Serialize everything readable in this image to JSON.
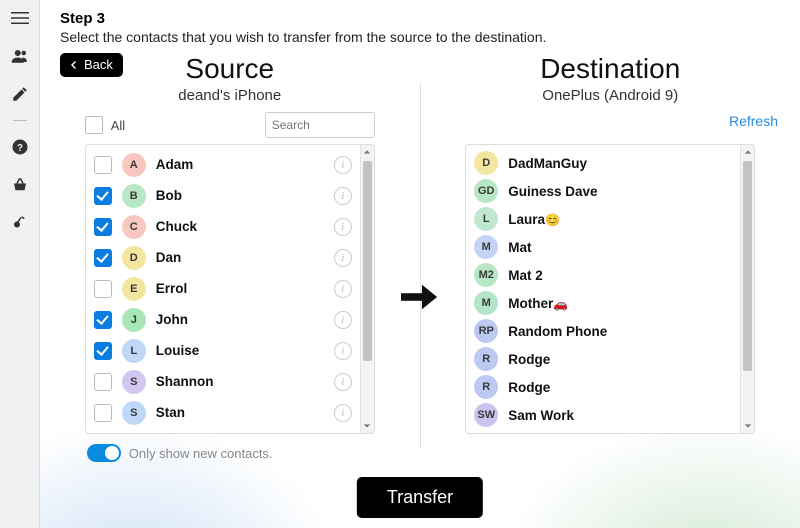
{
  "step": {
    "title": "Step 3",
    "desc": "Select the contacts that you wish to transfer from the source to the destination."
  },
  "back_label": "Back",
  "transfer_label": "Transfer",
  "source": {
    "title": "Source",
    "subtitle": "deand's iPhone",
    "all_label": "All",
    "search_placeholder": "Search",
    "toggle_label": "Only show new contacts.",
    "toggle_on": true,
    "contacts": [
      {
        "initial": "A",
        "name": "Adam",
        "color": "#f7c7c0",
        "checked": false
      },
      {
        "initial": "B",
        "name": "Bob",
        "color": "#b9e6c4",
        "checked": true
      },
      {
        "initial": "C",
        "name": "Chuck",
        "color": "#f7c7c0",
        "checked": true
      },
      {
        "initial": "D",
        "name": "Dan",
        "color": "#f3e6a0",
        "checked": true
      },
      {
        "initial": "E",
        "name": "Errol",
        "color": "#f3e6a0",
        "checked": false
      },
      {
        "initial": "J",
        "name": "John",
        "color": "#a9e6b7",
        "checked": true
      },
      {
        "initial": "L",
        "name": "Louise",
        "color": "#c0d8f7",
        "checked": true
      },
      {
        "initial": "S",
        "name": "Shannon",
        "color": "#d2c7f0",
        "checked": false
      },
      {
        "initial": "S",
        "name": "Stan",
        "color": "#c0d8f7",
        "checked": false
      }
    ]
  },
  "destination": {
    "title": "Destination",
    "subtitle": "OnePlus (Android 9)",
    "refresh_label": "Refresh",
    "contacts": [
      {
        "initial": "D",
        "name": "DadManGuy",
        "color": "#f3e6a0"
      },
      {
        "initial": "GD",
        "name": "Guiness Dave",
        "color": "#b9e6c4"
      },
      {
        "initial": "L",
        "name": "Laura",
        "color": "#c0e7cf",
        "emoji": "😊"
      },
      {
        "initial": "M",
        "name": "Mat",
        "color": "#c3d3f5"
      },
      {
        "initial": "M2",
        "name": "Mat 2",
        "color": "#b9e6c4"
      },
      {
        "initial": "M",
        "name": "Mother",
        "color": "#b3e6c8",
        "emoji": "🚗"
      },
      {
        "initial": "RP",
        "name": "Random Phone",
        "color": "#bcc9f3"
      },
      {
        "initial": "R",
        "name": "Rodge",
        "color": "#bcc9f3"
      },
      {
        "initial": "R",
        "name": "Rodge",
        "color": "#bcc9f3"
      },
      {
        "initial": "SW",
        "name": "Sam Work",
        "color": "#cac4ef"
      }
    ]
  },
  "sidebar_icons": [
    "menu",
    "contacts",
    "edit",
    "divider",
    "help",
    "basket",
    "key"
  ]
}
